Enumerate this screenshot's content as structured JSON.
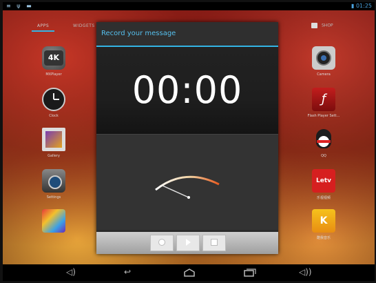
{
  "status": {
    "left_icons": "≡ ψ ▬",
    "time": "01:25"
  },
  "tabs": {
    "apps": "APPS",
    "widgets": "WIDGETS",
    "store": "SHOP"
  },
  "apps_left": [
    {
      "name": "MXPlayer",
      "icon_text": "4K"
    },
    {
      "name": "Clock",
      "icon_text": ""
    },
    {
      "name": "Gallery",
      "icon_text": ""
    },
    {
      "name": "Settings",
      "icon_text": ""
    },
    {
      "name": "",
      "icon_text": ""
    }
  ],
  "apps_right": [
    {
      "name": "Camera",
      "icon_text": ""
    },
    {
      "name": "Flash Player Sett...",
      "icon_text": ""
    },
    {
      "name": "QQ",
      "icon_text": ""
    },
    {
      "name": "乐视视频",
      "icon_text": "Letv"
    },
    {
      "name": "酷我音乐",
      "icon_text": "K"
    }
  ],
  "dialog": {
    "title": "Record your message",
    "timer": "00:00",
    "buttons": [
      "record",
      "play",
      "stop"
    ]
  },
  "nav": {
    "icons": [
      "volume-down-icon",
      "back-icon",
      "home-icon",
      "recent-apps-icon",
      "volume-up-icon"
    ]
  },
  "colors": {
    "accent": "#33b5e5",
    "title": "#56c0ee"
  }
}
